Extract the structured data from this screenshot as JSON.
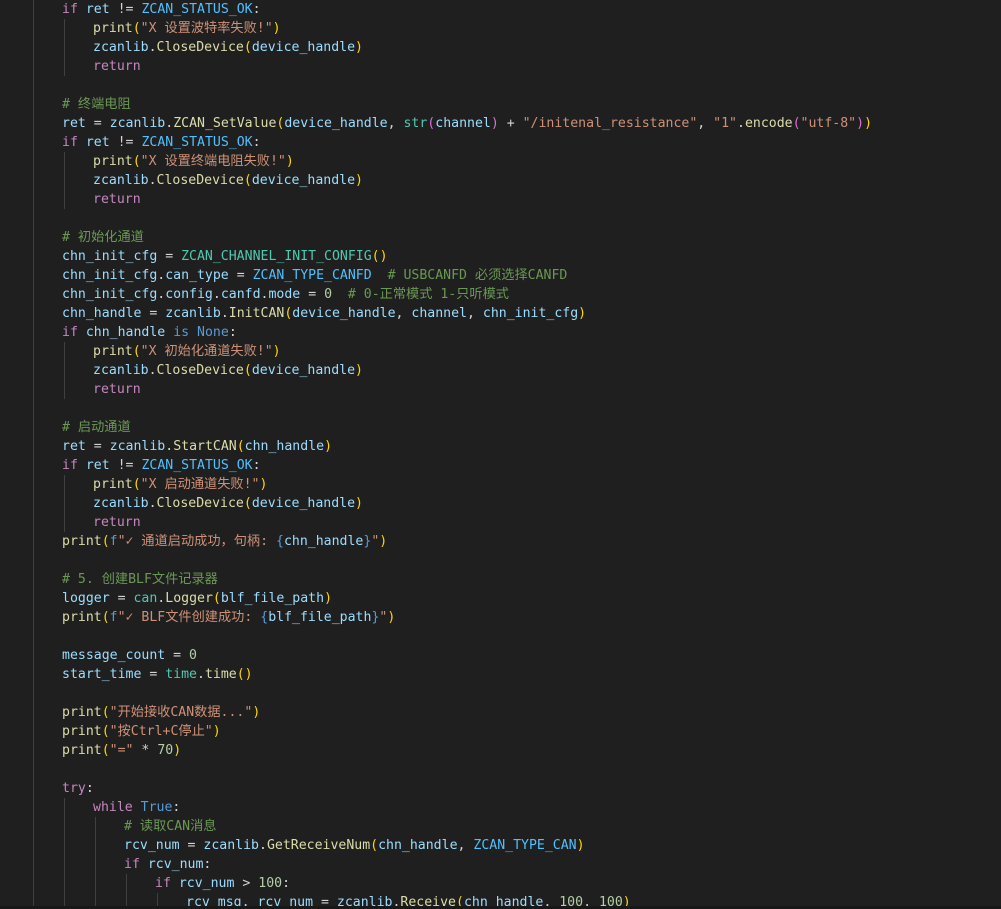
{
  "editor": {
    "language": "python",
    "theme_colors": {
      "background": "#1f1f1f",
      "keyword": "#c586c0",
      "builtin_constant": "#569cd6",
      "function": "#dcdcaa",
      "variable": "#9cdcfe",
      "string": "#ce9178",
      "number": "#b5cea8",
      "comment": "#6a9955",
      "class": "#4ec9b0",
      "constant": "#4fc1ff",
      "bracket_level_1": "#ffd700",
      "bracket_level_2": "#da70d6",
      "bracket_level_3": "#179fff"
    },
    "lines": [
      {
        "indent": 1,
        "tokens": [
          [
            "if",
            "kw"
          ],
          [
            " ",
            ""
          ],
          [
            "ret",
            "var"
          ],
          [
            " != ",
            "op"
          ],
          [
            "ZCAN_STATUS_OK",
            "const"
          ],
          [
            ":",
            "pun"
          ]
        ]
      },
      {
        "indent": 2,
        "tokens": [
          [
            "print",
            "fn"
          ],
          [
            "(",
            "br1"
          ],
          [
            "\"X 设置波特率失败!\"",
            "str"
          ],
          [
            ")",
            "br1"
          ]
        ]
      },
      {
        "indent": 2,
        "tokens": [
          [
            "zcanlib",
            "var"
          ],
          [
            ".",
            "pun"
          ],
          [
            "CloseDevice",
            "fn"
          ],
          [
            "(",
            "br1"
          ],
          [
            "device_handle",
            "var"
          ],
          [
            ")",
            "br1"
          ]
        ]
      },
      {
        "indent": 2,
        "tokens": [
          [
            "return",
            "kw"
          ]
        ]
      },
      {
        "indent": 0,
        "tokens": []
      },
      {
        "indent": 1,
        "tokens": [
          [
            "# 终端电阻",
            "com"
          ]
        ]
      },
      {
        "indent": 1,
        "tokens": [
          [
            "ret",
            "var"
          ],
          [
            " = ",
            "op"
          ],
          [
            "zcanlib",
            "var"
          ],
          [
            ".",
            "pun"
          ],
          [
            "ZCAN_SetValue",
            "fn"
          ],
          [
            "(",
            "br1"
          ],
          [
            "device_handle",
            "var"
          ],
          [
            ", ",
            "pun"
          ],
          [
            "str",
            "cls"
          ],
          [
            "(",
            "br2"
          ],
          [
            "channel",
            "var"
          ],
          [
            ")",
            "br2"
          ],
          [
            " + ",
            "op"
          ],
          [
            "\"/initenal_resistance\"",
            "str"
          ],
          [
            ", ",
            "pun"
          ],
          [
            "\"1\"",
            "str"
          ],
          [
            ".",
            "pun"
          ],
          [
            "encode",
            "fn"
          ],
          [
            "(",
            "br2"
          ],
          [
            "\"utf-8\"",
            "str"
          ],
          [
            ")",
            "br2"
          ],
          [
            ")",
            "br1"
          ]
        ]
      },
      {
        "indent": 1,
        "tokens": [
          [
            "if",
            "kw"
          ],
          [
            " ",
            ""
          ],
          [
            "ret",
            "var"
          ],
          [
            " != ",
            "op"
          ],
          [
            "ZCAN_STATUS_OK",
            "const"
          ],
          [
            ":",
            "pun"
          ]
        ]
      },
      {
        "indent": 2,
        "tokens": [
          [
            "print",
            "fn"
          ],
          [
            "(",
            "br1"
          ],
          [
            "\"X 设置终端电阻失败!\"",
            "str"
          ],
          [
            ")",
            "br1"
          ]
        ]
      },
      {
        "indent": 2,
        "tokens": [
          [
            "zcanlib",
            "var"
          ],
          [
            ".",
            "pun"
          ],
          [
            "CloseDevice",
            "fn"
          ],
          [
            "(",
            "br1"
          ],
          [
            "device_handle",
            "var"
          ],
          [
            ")",
            "br1"
          ]
        ]
      },
      {
        "indent": 2,
        "tokens": [
          [
            "return",
            "kw"
          ]
        ]
      },
      {
        "indent": 0,
        "tokens": []
      },
      {
        "indent": 1,
        "tokens": [
          [
            "# 初始化通道",
            "com"
          ]
        ]
      },
      {
        "indent": 1,
        "tokens": [
          [
            "chn_init_cfg",
            "var"
          ],
          [
            " = ",
            "op"
          ],
          [
            "ZCAN_CHANNEL_INIT_CONFIG",
            "cls"
          ],
          [
            "(",
            "br1"
          ],
          [
            ")",
            "br1"
          ]
        ]
      },
      {
        "indent": 1,
        "tokens": [
          [
            "chn_init_cfg",
            "var"
          ],
          [
            ".",
            "pun"
          ],
          [
            "can_type",
            "var"
          ],
          [
            " = ",
            "op"
          ],
          [
            "ZCAN_TYPE_CANFD",
            "const"
          ],
          [
            "  ",
            ""
          ],
          [
            "# USBCANFD 必须选择CANFD",
            "com"
          ]
        ]
      },
      {
        "indent": 1,
        "tokens": [
          [
            "chn_init_cfg",
            "var"
          ],
          [
            ".",
            "pun"
          ],
          [
            "config",
            "var"
          ],
          [
            ".",
            "pun"
          ],
          [
            "canfd",
            "var"
          ],
          [
            ".",
            "pun"
          ],
          [
            "mode",
            "var"
          ],
          [
            " = ",
            "op"
          ],
          [
            "0",
            "num"
          ],
          [
            "  ",
            ""
          ],
          [
            "# 0-正常模式 1-只听模式",
            "com"
          ]
        ]
      },
      {
        "indent": 1,
        "tokens": [
          [
            "chn_handle",
            "var"
          ],
          [
            " = ",
            "op"
          ],
          [
            "zcanlib",
            "var"
          ],
          [
            ".",
            "pun"
          ],
          [
            "InitCAN",
            "fn"
          ],
          [
            "(",
            "br1"
          ],
          [
            "device_handle",
            "var"
          ],
          [
            ", ",
            "pun"
          ],
          [
            "channel",
            "var"
          ],
          [
            ", ",
            "pun"
          ],
          [
            "chn_init_cfg",
            "var"
          ],
          [
            ")",
            "br1"
          ]
        ]
      },
      {
        "indent": 1,
        "tokens": [
          [
            "if",
            "kw"
          ],
          [
            " ",
            ""
          ],
          [
            "chn_handle",
            "var"
          ],
          [
            " ",
            ""
          ],
          [
            "is",
            "def"
          ],
          [
            " ",
            ""
          ],
          [
            "None",
            "def"
          ],
          [
            ":",
            "pun"
          ]
        ]
      },
      {
        "indent": 2,
        "tokens": [
          [
            "print",
            "fn"
          ],
          [
            "(",
            "br1"
          ],
          [
            "\"X 初始化通道失败!\"",
            "str"
          ],
          [
            ")",
            "br1"
          ]
        ]
      },
      {
        "indent": 2,
        "tokens": [
          [
            "zcanlib",
            "var"
          ],
          [
            ".",
            "pun"
          ],
          [
            "CloseDevice",
            "fn"
          ],
          [
            "(",
            "br1"
          ],
          [
            "device_handle",
            "var"
          ],
          [
            ")",
            "br1"
          ]
        ]
      },
      {
        "indent": 2,
        "tokens": [
          [
            "return",
            "kw"
          ]
        ]
      },
      {
        "indent": 0,
        "tokens": []
      },
      {
        "indent": 1,
        "tokens": [
          [
            "# 启动通道",
            "com"
          ]
        ]
      },
      {
        "indent": 1,
        "tokens": [
          [
            "ret",
            "var"
          ],
          [
            " = ",
            "op"
          ],
          [
            "zcanlib",
            "var"
          ],
          [
            ".",
            "pun"
          ],
          [
            "StartCAN",
            "fn"
          ],
          [
            "(",
            "br1"
          ],
          [
            "chn_handle",
            "var"
          ],
          [
            ")",
            "br1"
          ]
        ]
      },
      {
        "indent": 1,
        "tokens": [
          [
            "if",
            "kw"
          ],
          [
            " ",
            ""
          ],
          [
            "ret",
            "var"
          ],
          [
            " != ",
            "op"
          ],
          [
            "ZCAN_STATUS_OK",
            "const"
          ],
          [
            ":",
            "pun"
          ]
        ]
      },
      {
        "indent": 2,
        "tokens": [
          [
            "print",
            "fn"
          ],
          [
            "(",
            "br1"
          ],
          [
            "\"X 启动通道失败!\"",
            "str"
          ],
          [
            ")",
            "br1"
          ]
        ]
      },
      {
        "indent": 2,
        "tokens": [
          [
            "zcanlib",
            "var"
          ],
          [
            ".",
            "pun"
          ],
          [
            "CloseDevice",
            "fn"
          ],
          [
            "(",
            "br1"
          ],
          [
            "device_handle",
            "var"
          ],
          [
            ")",
            "br1"
          ]
        ]
      },
      {
        "indent": 2,
        "tokens": [
          [
            "return",
            "kw"
          ]
        ]
      },
      {
        "indent": 1,
        "tokens": [
          [
            "print",
            "fn"
          ],
          [
            "(",
            "br1"
          ],
          [
            "f",
            "def"
          ],
          [
            "\"✓ 通道启动成功，句柄: ",
            "str"
          ],
          [
            "{",
            "def"
          ],
          [
            "chn_handle",
            "var"
          ],
          [
            "}",
            "def"
          ],
          [
            "\"",
            "str"
          ],
          [
            ")",
            "br1"
          ]
        ]
      },
      {
        "indent": 0,
        "tokens": []
      },
      {
        "indent": 1,
        "tokens": [
          [
            "# 5. 创建BLF文件记录器",
            "com"
          ]
        ]
      },
      {
        "indent": 1,
        "tokens": [
          [
            "logger",
            "var"
          ],
          [
            " = ",
            "op"
          ],
          [
            "can",
            "cls"
          ],
          [
            ".",
            "pun"
          ],
          [
            "Logger",
            "fn"
          ],
          [
            "(",
            "br1"
          ],
          [
            "blf_file_path",
            "var"
          ],
          [
            ")",
            "br1"
          ]
        ]
      },
      {
        "indent": 1,
        "tokens": [
          [
            "print",
            "fn"
          ],
          [
            "(",
            "br1"
          ],
          [
            "f",
            "def"
          ],
          [
            "\"✓ BLF文件创建成功: ",
            "str"
          ],
          [
            "{",
            "def"
          ],
          [
            "blf_file_path",
            "var"
          ],
          [
            "}",
            "def"
          ],
          [
            "\"",
            "str"
          ],
          [
            ")",
            "br1"
          ]
        ]
      },
      {
        "indent": 0,
        "tokens": []
      },
      {
        "indent": 1,
        "tokens": [
          [
            "message_count",
            "var"
          ],
          [
            " = ",
            "op"
          ],
          [
            "0",
            "num"
          ]
        ]
      },
      {
        "indent": 1,
        "tokens": [
          [
            "start_time",
            "var"
          ],
          [
            " = ",
            "op"
          ],
          [
            "time",
            "cls"
          ],
          [
            ".",
            "pun"
          ],
          [
            "time",
            "fn"
          ],
          [
            "(",
            "br1"
          ],
          [
            ")",
            "br1"
          ]
        ]
      },
      {
        "indent": 0,
        "tokens": []
      },
      {
        "indent": 1,
        "tokens": [
          [
            "print",
            "fn"
          ],
          [
            "(",
            "br1"
          ],
          [
            "\"开始接收CAN数据...\"",
            "str"
          ],
          [
            ")",
            "br1"
          ]
        ]
      },
      {
        "indent": 1,
        "tokens": [
          [
            "print",
            "fn"
          ],
          [
            "(",
            "br1"
          ],
          [
            "\"按Ctrl+C停止\"",
            "str"
          ],
          [
            ")",
            "br1"
          ]
        ]
      },
      {
        "indent": 1,
        "tokens": [
          [
            "print",
            "fn"
          ],
          [
            "(",
            "br1"
          ],
          [
            "\"=\"",
            "str"
          ],
          [
            " * ",
            "op"
          ],
          [
            "70",
            "num"
          ],
          [
            ")",
            "br1"
          ]
        ]
      },
      {
        "indent": 0,
        "tokens": []
      },
      {
        "indent": 1,
        "tokens": [
          [
            "try",
            "kw"
          ],
          [
            ":",
            "pun"
          ]
        ]
      },
      {
        "indent": 2,
        "tokens": [
          [
            "while",
            "kw"
          ],
          [
            " ",
            ""
          ],
          [
            "True",
            "def"
          ],
          [
            ":",
            "pun"
          ]
        ]
      },
      {
        "indent": 3,
        "tokens": [
          [
            "# 读取CAN消息",
            "com"
          ]
        ]
      },
      {
        "indent": 3,
        "tokens": [
          [
            "rcv_num",
            "var"
          ],
          [
            " = ",
            "op"
          ],
          [
            "zcanlib",
            "var"
          ],
          [
            ".",
            "pun"
          ],
          [
            "GetReceiveNum",
            "fn"
          ],
          [
            "(",
            "br1"
          ],
          [
            "chn_handle",
            "var"
          ],
          [
            ", ",
            "pun"
          ],
          [
            "ZCAN_TYPE_CAN",
            "const"
          ],
          [
            ")",
            "br1"
          ]
        ]
      },
      {
        "indent": 3,
        "tokens": [
          [
            "if",
            "kw"
          ],
          [
            " ",
            ""
          ],
          [
            "rcv_num",
            "var"
          ],
          [
            ":",
            "pun"
          ]
        ]
      },
      {
        "indent": 4,
        "tokens": [
          [
            "if",
            "kw"
          ],
          [
            " ",
            ""
          ],
          [
            "rcv_num",
            "var"
          ],
          [
            " > ",
            "op"
          ],
          [
            "100",
            "num"
          ],
          [
            ":",
            "pun"
          ]
        ]
      },
      {
        "indent": 5,
        "tokens": [
          [
            "rcv_msg",
            "var"
          ],
          [
            ", ",
            "pun"
          ],
          [
            "rcv_num",
            "var"
          ],
          [
            " = ",
            "op"
          ],
          [
            "zcanlib",
            "var"
          ],
          [
            ".",
            "pun"
          ],
          [
            "Receive",
            "fn"
          ],
          [
            "(",
            "br1"
          ],
          [
            "chn_handle",
            "var"
          ],
          [
            ", ",
            "pun"
          ],
          [
            "100",
            "num"
          ],
          [
            ", ",
            "pun"
          ],
          [
            "100",
            "num"
          ],
          [
            ")",
            "br1"
          ]
        ]
      }
    ]
  }
}
